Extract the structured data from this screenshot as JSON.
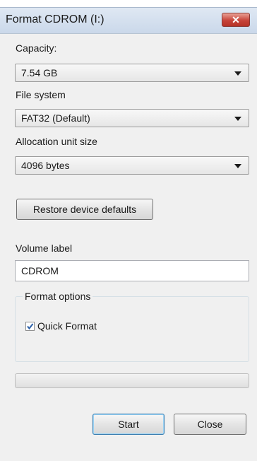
{
  "window": {
    "title": "Format CDROM (I:)",
    "close_label": "✕"
  },
  "capacity": {
    "label": "Capacity:",
    "value": "7.54 GB"
  },
  "file_system": {
    "label": "File system",
    "value": "FAT32 (Default)"
  },
  "allocation": {
    "label": "Allocation unit size",
    "value": "4096 bytes"
  },
  "restore_button": "Restore device defaults",
  "volume": {
    "label": "Volume label",
    "value": "CDROM"
  },
  "format_options": {
    "legend": "Format options",
    "quick_format_label": "Quick Format",
    "quick_format_checked": true
  },
  "progress_percent": 0,
  "buttons": {
    "start": "Start",
    "close": "Close"
  }
}
